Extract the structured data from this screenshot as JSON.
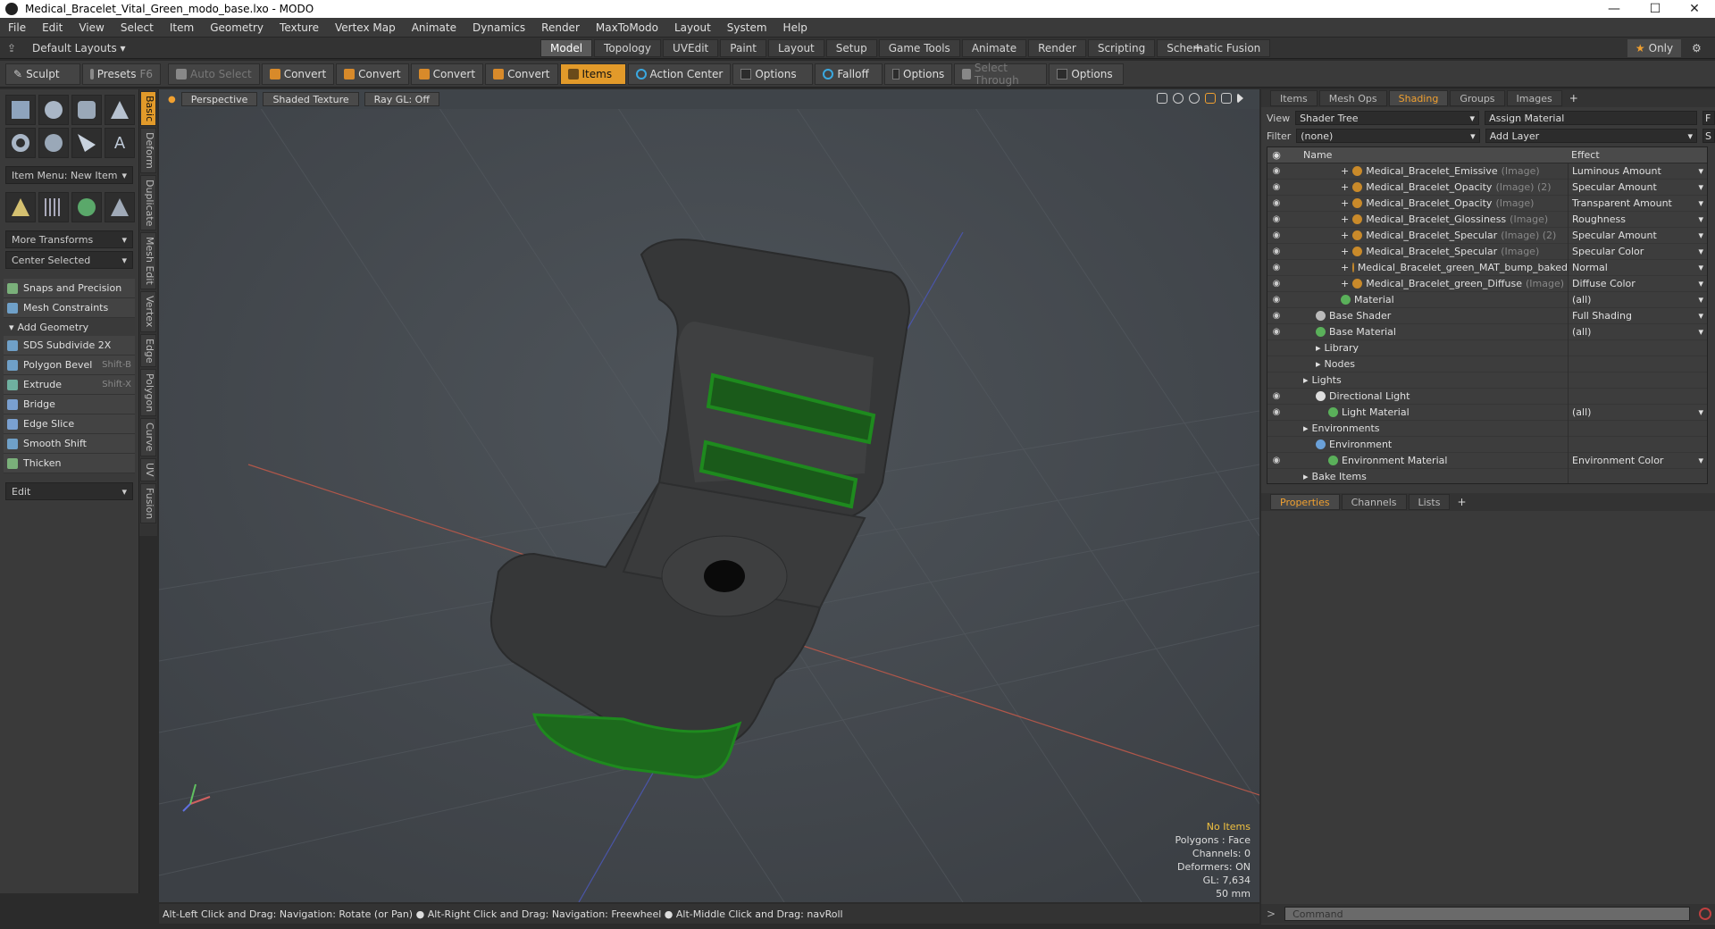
{
  "window": {
    "title": "Medical_Bracelet_Vital_Green_modo_base.lxo - MODO"
  },
  "menu": [
    "File",
    "Edit",
    "View",
    "Select",
    "Item",
    "Geometry",
    "Texture",
    "Vertex Map",
    "Animate",
    "Dynamics",
    "Render",
    "MaxToModo",
    "Layout",
    "System",
    "Help"
  ],
  "layouts": {
    "dropdown": "Default Layouts",
    "tabs": [
      "Model",
      "Topology",
      "UVEdit",
      "Paint",
      "Layout",
      "Setup",
      "Game Tools",
      "Animate",
      "Render",
      "Scripting",
      "Schematic Fusion"
    ],
    "active": "Model",
    "plus": "+",
    "only": "Only"
  },
  "toolbar": {
    "sculpt": "Sculpt",
    "presets": "Presets",
    "presets_key": "F6",
    "auto_select": "Auto Select",
    "convert1": "Convert",
    "convert2": "Convert",
    "convert3": "Convert",
    "convert4": "Convert",
    "items": "Items",
    "action_center": "Action Center",
    "options1": "Options",
    "falloff": "Falloff",
    "options2": "Options",
    "select_through": "Select Through",
    "options3": "Options"
  },
  "left": {
    "vtabs": [
      "Basic",
      "Deform",
      "Duplicate",
      "Mesh Edit",
      "Vertex",
      "Edge",
      "Polygon",
      "Curve",
      "UV",
      "Fusion"
    ],
    "item_menu": "Item Menu: New Item",
    "more_transforms": "More Transforms",
    "center_selected": "Center Selected",
    "snaps": "Snaps and Precision",
    "mesh_constraints": "Mesh Constraints",
    "add_geometry": "Add Geometry",
    "tools": [
      {
        "label": "SDS Subdivide 2X",
        "key": ""
      },
      {
        "label": "Polygon Bevel",
        "key": "Shift-B"
      },
      {
        "label": "Extrude",
        "key": "Shift-X"
      },
      {
        "label": "Bridge",
        "key": ""
      },
      {
        "label": "Edge Slice",
        "key": ""
      },
      {
        "label": "Smooth Shift",
        "key": ""
      },
      {
        "label": "Thicken",
        "key": ""
      }
    ],
    "edit": "Edit"
  },
  "viewport": {
    "perspective": "Perspective",
    "shaded": "Shaded Texture",
    "raygl": "Ray GL: Off",
    "stats": {
      "no_items": "No Items",
      "polygons": "Polygons : Face",
      "channels": "Channels: 0",
      "deformers": "Deformers: ON",
      "gl": "GL: 7,634",
      "scale": "50 mm"
    }
  },
  "status": "Alt-Left Click and Drag: Navigation: Rotate (or Pan) ● Alt-Right Click and Drag: Navigation: Freewheel ● Alt-Middle Click and Drag: navRoll",
  "right": {
    "tabs": [
      "Items",
      "Mesh Ops",
      "Shading",
      "Groups",
      "Images"
    ],
    "active_tab": "Shading",
    "view_label": "View",
    "view_value": "Shader Tree",
    "assign_material": "Assign Material",
    "filter_label": "Filter",
    "filter_value": "(none)",
    "add_layer": "Add Layer",
    "col_name": "Name",
    "col_effect": "Effect",
    "rows": [
      {
        "name": "Medical_Bracelet_Emissive",
        "tag": "(Image)",
        "effect": "Luminous Amount",
        "indent": 3,
        "ball": "#c98a2a",
        "eye": true
      },
      {
        "name": "Medical_Bracelet_Opacity",
        "tag": "(Image) (2)",
        "effect": "Specular Amount",
        "indent": 3,
        "ball": "#c98a2a",
        "eye": true
      },
      {
        "name": "Medical_Bracelet_Opacity",
        "tag": "(Image)",
        "effect": "Transparent Amount",
        "indent": 3,
        "ball": "#c98a2a",
        "eye": true
      },
      {
        "name": "Medical_Bracelet_Glossiness",
        "tag": "(Image)",
        "effect": "Roughness",
        "indent": 3,
        "ball": "#c98a2a",
        "eye": true
      },
      {
        "name": "Medical_Bracelet_Specular",
        "tag": "(Image) (2)",
        "effect": "Specular Amount",
        "indent": 3,
        "ball": "#c98a2a",
        "eye": true
      },
      {
        "name": "Medical_Bracelet_Specular",
        "tag": "(Image)",
        "effect": "Specular Color",
        "indent": 3,
        "ball": "#c98a2a",
        "eye": true
      },
      {
        "name": "Medical_Bracelet_green_MAT_bump_baked",
        "tag": "",
        "effect": "Normal",
        "indent": 3,
        "ball": "#c98a2a",
        "eye": true
      },
      {
        "name": "Medical_Bracelet_green_Diffuse",
        "tag": "(Image)",
        "effect": "Diffuse Color",
        "indent": 3,
        "ball": "#c98a2a",
        "eye": true
      },
      {
        "name": "Material",
        "tag": "",
        "effect": "(all)",
        "indent": 3,
        "ball": "#5ab05a",
        "eye": true
      },
      {
        "name": "Base Shader",
        "tag": "",
        "effect": "Full Shading",
        "indent": 1,
        "ball": "#bbbbbb",
        "eye": true
      },
      {
        "name": "Base Material",
        "tag": "",
        "effect": "(all)",
        "indent": 1,
        "ball": "#5ab05a",
        "eye": true
      },
      {
        "name": "Library",
        "tag": "",
        "effect": "",
        "indent": 1,
        "ball": "",
        "eye": false
      },
      {
        "name": "Nodes",
        "tag": "",
        "effect": "",
        "indent": 1,
        "ball": "",
        "eye": false
      },
      {
        "name": "Lights",
        "tag": "",
        "effect": "",
        "indent": 0,
        "ball": "",
        "eye": false
      },
      {
        "name": "Directional Light",
        "tag": "",
        "effect": "",
        "indent": 1,
        "ball": "#dddddd",
        "eye": true
      },
      {
        "name": "Light Material",
        "tag": "",
        "effect": "(all)",
        "indent": 2,
        "ball": "#5ab05a",
        "eye": true
      },
      {
        "name": "Environments",
        "tag": "",
        "effect": "",
        "indent": 0,
        "ball": "",
        "eye": false
      },
      {
        "name": "Environment",
        "tag": "",
        "effect": "",
        "indent": 1,
        "ball": "#6aa0d8",
        "eye": false
      },
      {
        "name": "Environment Material",
        "tag": "",
        "effect": "Environment Color",
        "indent": 2,
        "ball": "#5ab05a",
        "eye": true
      },
      {
        "name": "Bake Items",
        "tag": "",
        "effect": "",
        "indent": 0,
        "ball": "",
        "eye": false
      }
    ],
    "prop_tabs": [
      "Properties",
      "Channels",
      "Lists"
    ],
    "command_placeholder": "Command"
  }
}
